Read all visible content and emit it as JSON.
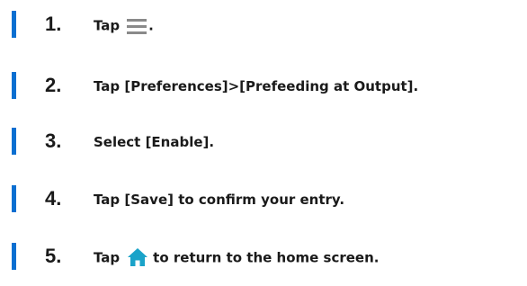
{
  "steps": [
    {
      "number": "1.",
      "text_before": "Tap",
      "icon": "menu-icon",
      "text_after": "."
    },
    {
      "number": "2.",
      "text": "Tap [Preferences]>[Prefeeding at Output]."
    },
    {
      "number": "3.",
      "text": "Select [Enable]."
    },
    {
      "number": "4.",
      "text": "Tap [Save] to confirm your entry."
    },
    {
      "number": "5.",
      "text_before": "Tap",
      "icon": "home-icon",
      "text_after": "to return to the home screen."
    }
  ],
  "colors": {
    "accent_bar": "#0a6fd1",
    "menu_icon": "#8a8a8a",
    "home_icon": "#1aa3c9",
    "text": "#1a1a1a"
  }
}
